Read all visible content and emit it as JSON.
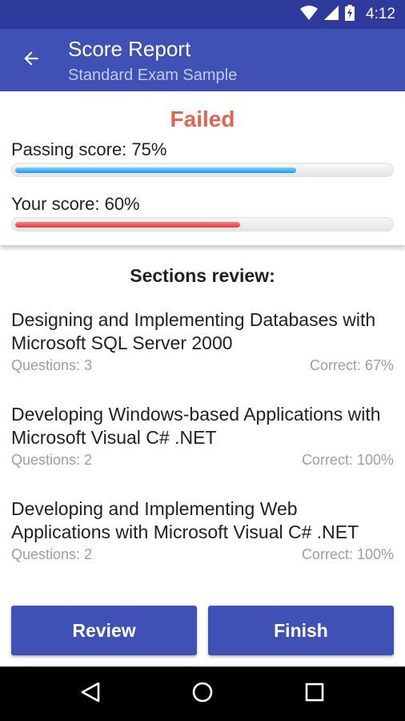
{
  "status_bar": {
    "time": "4:12"
  },
  "app_bar": {
    "title": "Score Report",
    "subtitle": "Standard Exam Sample",
    "back_icon": "arrow-back-icon"
  },
  "score": {
    "result": "Failed",
    "result_color": "#e06652",
    "passing_label": "Passing score: 75%",
    "passing_value": 75,
    "your_label": "Your score: 60%",
    "your_value": 60
  },
  "sections": {
    "title": "Sections review:",
    "items": [
      {
        "name": "Designing and Implementing Databases with Microsoft SQL Server 2000",
        "questions": "Questions: 3",
        "correct": "Correct: 67%"
      },
      {
        "name": "Developing Windows-based Applications with Microsoft Visual C# .NET",
        "questions": "Questions: 2",
        "correct": "Correct: 100%"
      },
      {
        "name": "Developing and Implementing Web Applications with Microsoft Visual C# .NET",
        "questions": "Questions: 2",
        "correct": "Correct: 100%"
      }
    ]
  },
  "buttons": {
    "review": "Review",
    "finish": "Finish"
  },
  "colors": {
    "primary": "#3f51b5",
    "primary_dark": "#2f3b9c",
    "passing_bar": "#2196f3",
    "score_bar": "#e53935"
  }
}
